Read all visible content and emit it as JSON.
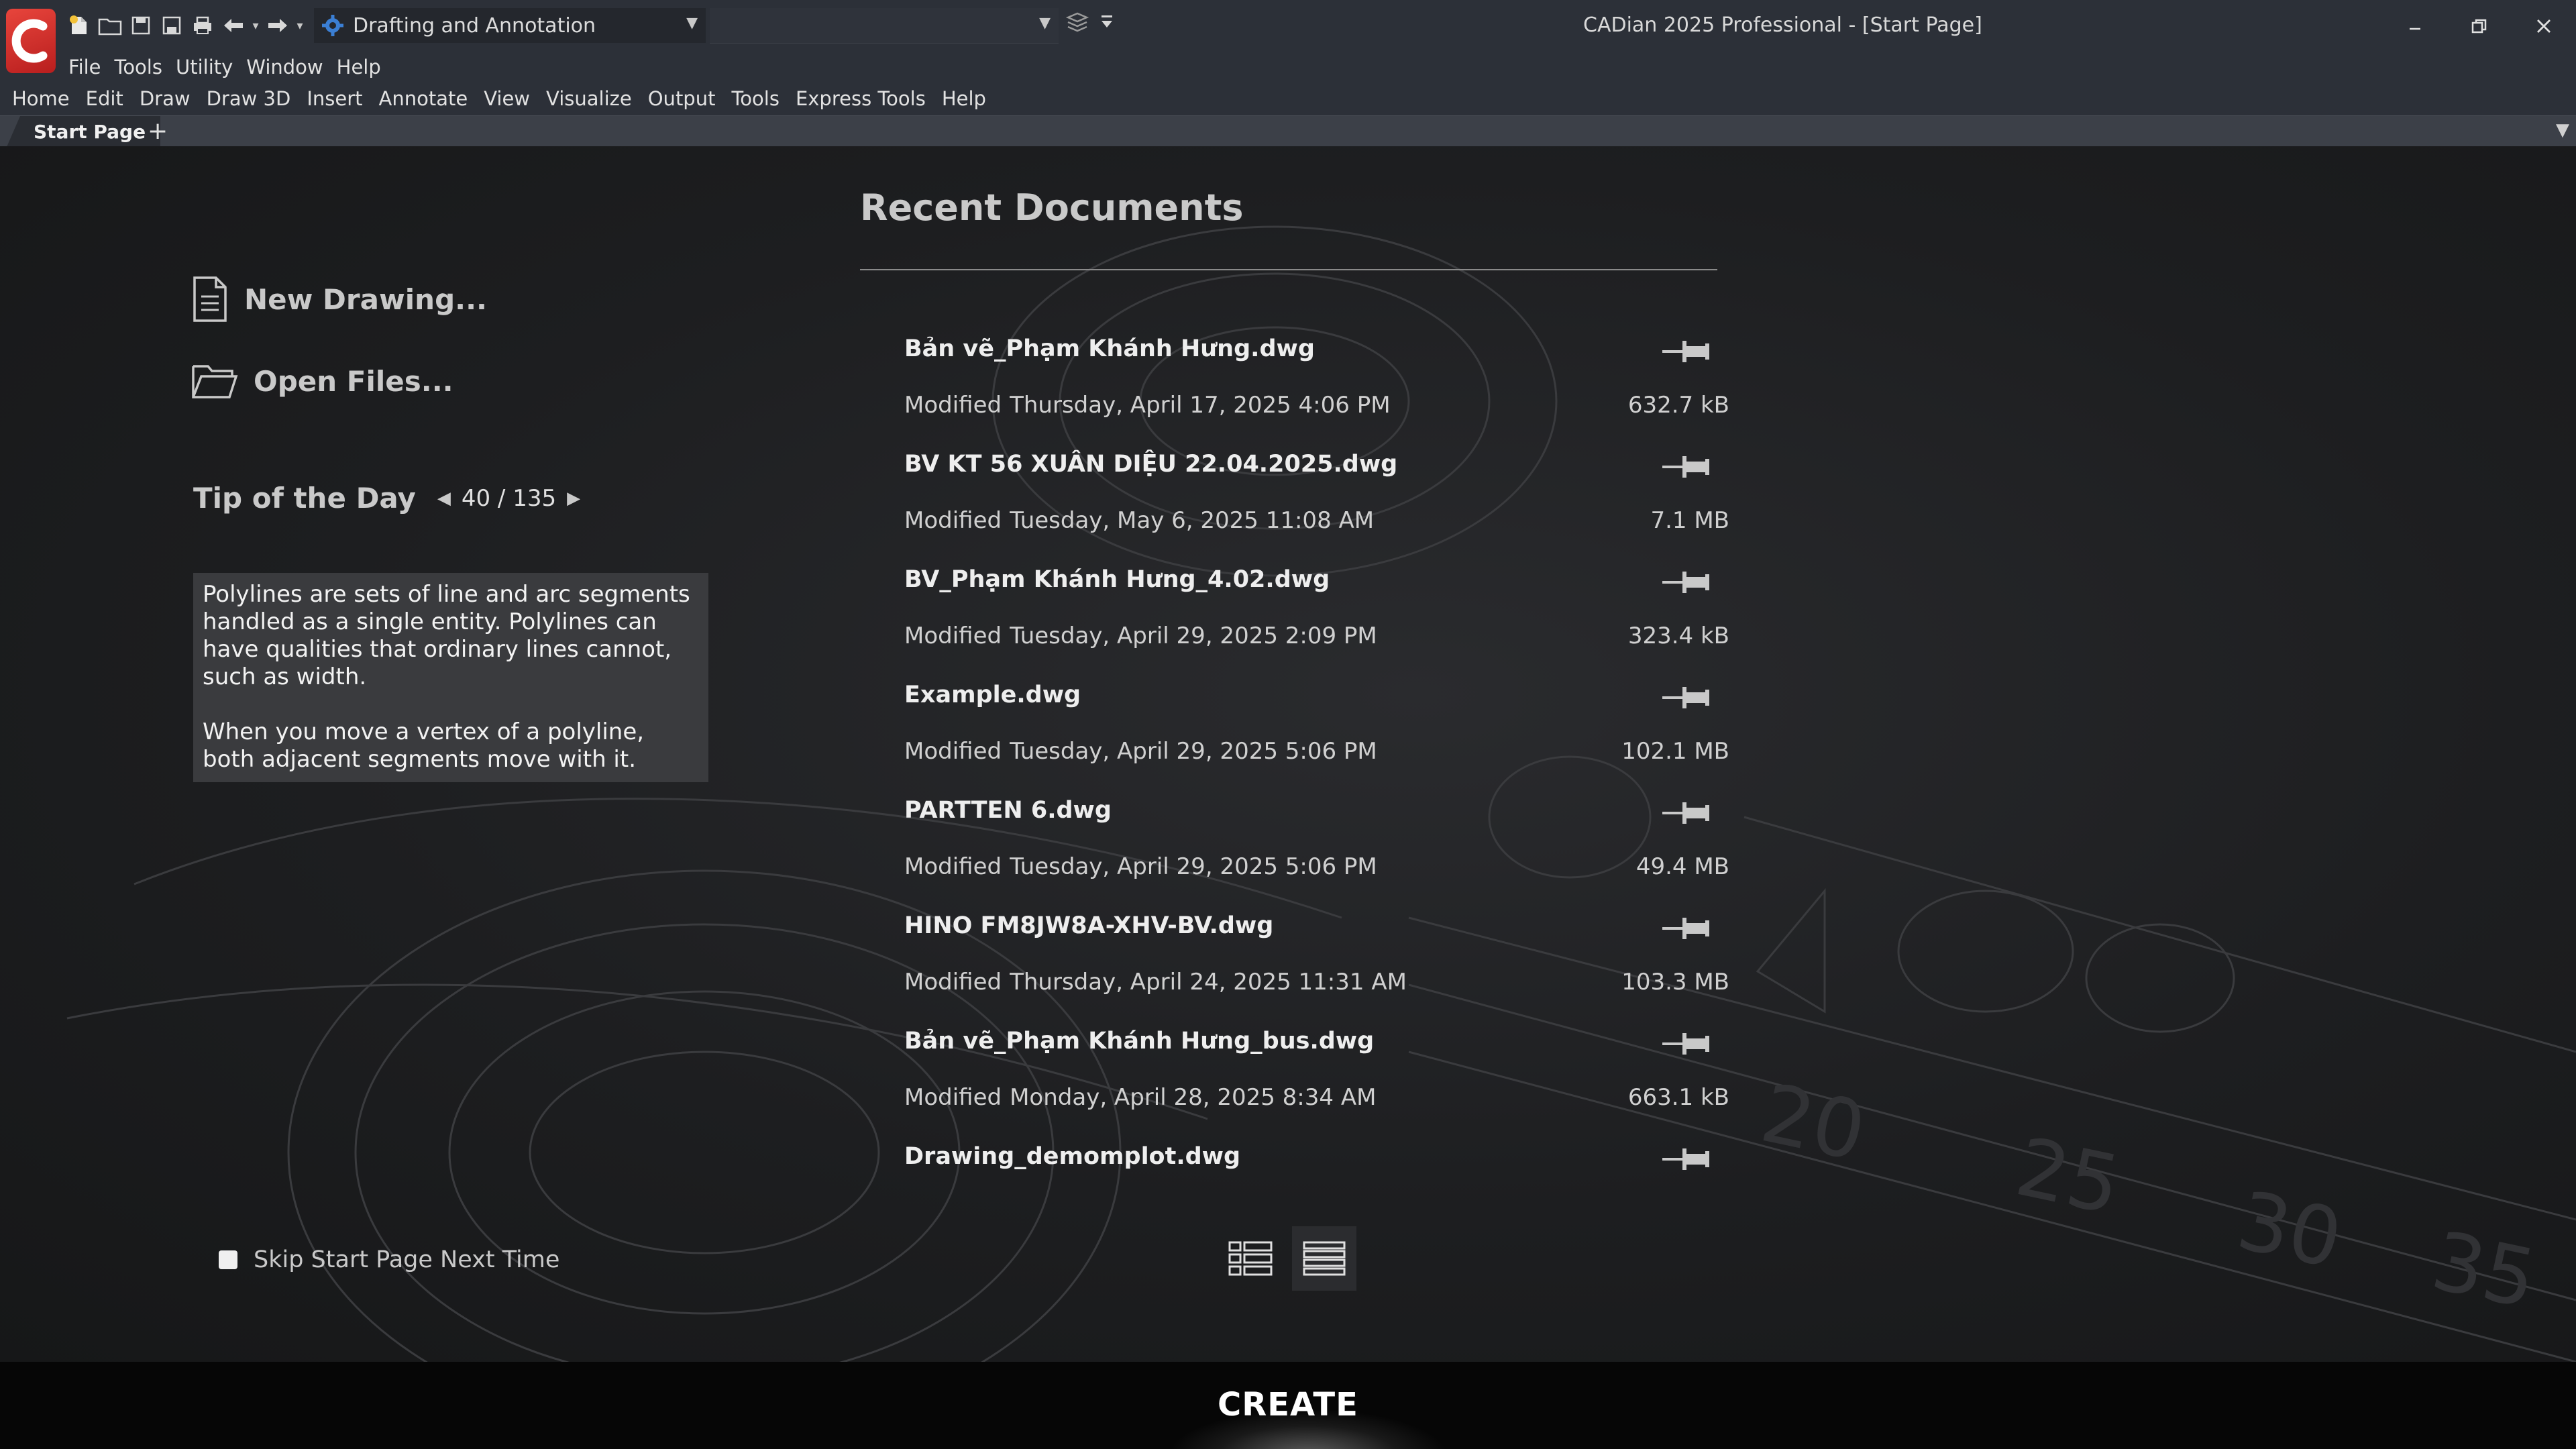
{
  "window": {
    "title": "CADian 2025 Professional - [Start Page]",
    "workspace": "Drafting and Annotation",
    "layer": ""
  },
  "menubar_primary": [
    "File",
    "Tools",
    "Utility",
    "Window",
    "Help"
  ],
  "menubar_ribbon": [
    "Home",
    "Edit",
    "Draw",
    "Draw 3D",
    "Insert",
    "Annotate",
    "View",
    "Visualize",
    "Output",
    "Tools",
    "Express Tools",
    "Help"
  ],
  "tabs": {
    "start_page": "Start Page",
    "add": "+"
  },
  "start": {
    "new_drawing": "New Drawing...",
    "open_files": "Open Files...",
    "tip": {
      "title": "Tip of the Day",
      "counter": "40 / 135",
      "paragraph1": "Polylines are sets of line and arc segments handled as a single entity. Polylines can have qualities that ordinary lines cannot, such as width.",
      "paragraph2": "When you move a vertex of a polyline, both adjacent segments move with it."
    },
    "skip_label": "Skip Start Page Next Time",
    "recent_title": "Recent Documents",
    "modified_prefix": "Modified",
    "documents": [
      {
        "name": "Bản vẽ_Phạm Khánh Hưng.dwg",
        "modified": "Thursday, April 17, 2025 4:06 PM",
        "size": "632.7 kB"
      },
      {
        "name": "BV KT 56 XUÂN DIỆU 22.04.2025.dwg",
        "modified": "Tuesday, May 6, 2025 11:08 AM",
        "size": "7.1 MB"
      },
      {
        "name": "BV_Phạm Khánh Hưng_4.02.dwg",
        "modified": "Tuesday, April 29, 2025 2:09 PM",
        "size": "323.4 kB"
      },
      {
        "name": "Example.dwg",
        "modified": "Tuesday, April 29, 2025 5:06 PM",
        "size": "102.1 MB"
      },
      {
        "name": "PARTTEN 6.dwg",
        "modified": "Tuesday, April 29, 2025 5:06 PM",
        "size": "49.4 MB"
      },
      {
        "name": "HINO FM8JW8A-XHV-BV.dwg",
        "modified": "Thursday, April 24, 2025 11:31 AM",
        "size": "103.3 MB"
      },
      {
        "name": "Bản vẽ_Phạm Khánh Hưng_bus.dwg",
        "modified": "Monday, April 28, 2025 8:34 AM",
        "size": "663.1 kB"
      },
      {
        "name": "Drawing_demomplot.dwg",
        "modified": "",
        "size": ""
      }
    ],
    "create_label": "CREATE"
  },
  "colors": {
    "accent_red": "#d42a2a",
    "background": "#1b1c1e",
    "titlebar": "#2c3038"
  }
}
